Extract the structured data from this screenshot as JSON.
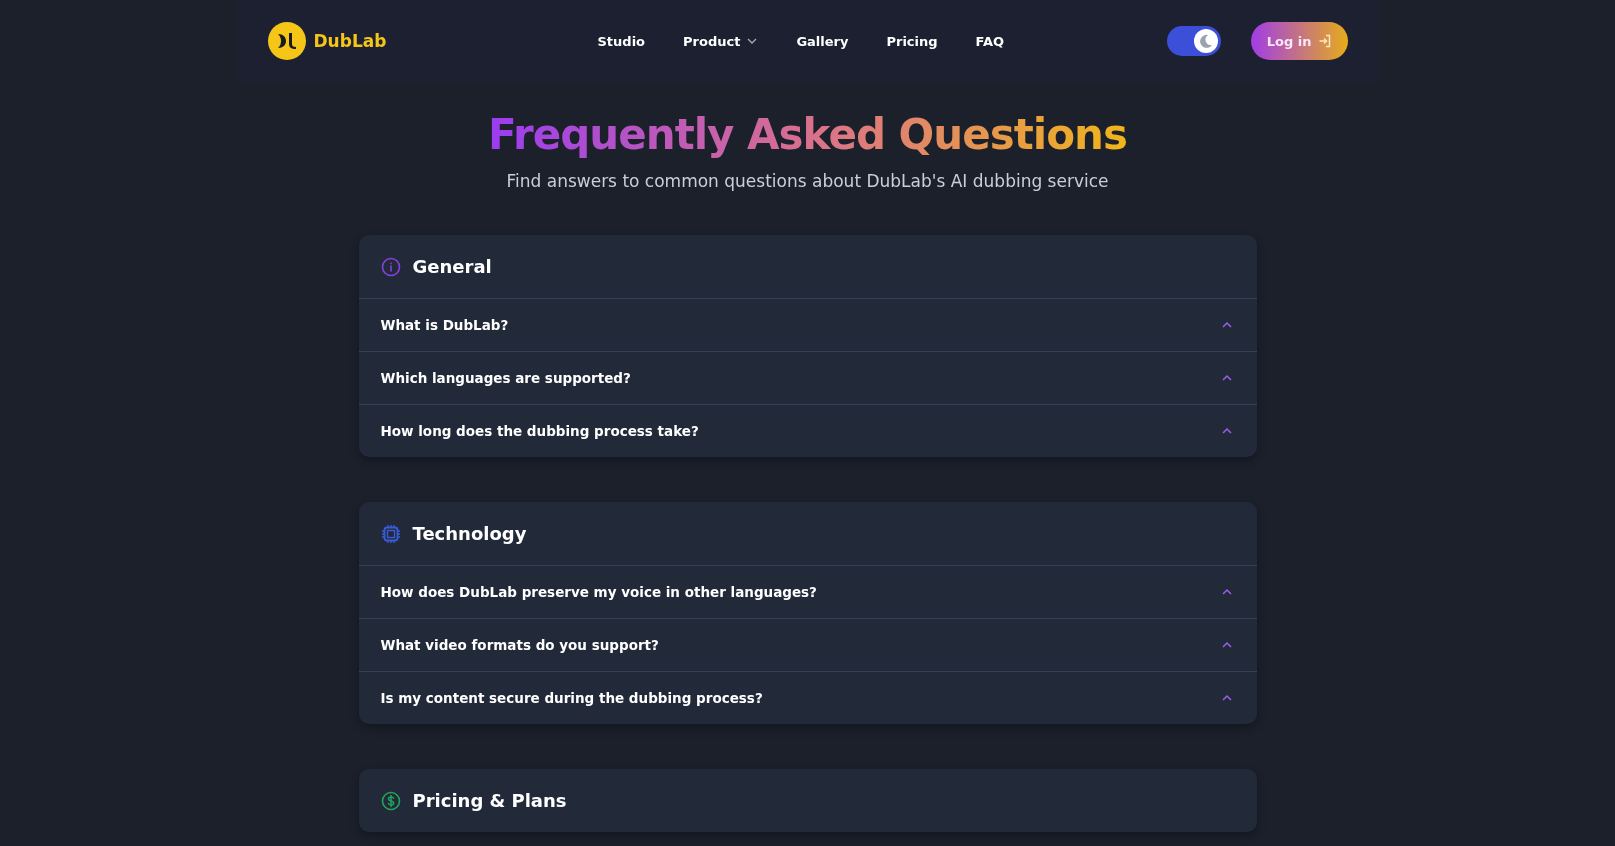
{
  "header": {
    "logo": "DubLab",
    "nav": [
      {
        "label": "Studio",
        "dropdown": false
      },
      {
        "label": "Product",
        "dropdown": true
      },
      {
        "label": "Gallery",
        "dropdown": false
      },
      {
        "label": "Pricing",
        "dropdown": false
      },
      {
        "label": "FAQ",
        "dropdown": false
      }
    ],
    "dark_mode": {
      "on": true
    },
    "login": "Log in"
  },
  "hero": {
    "title": "Frequently Asked Questions",
    "subtitle": "Find answers to common questions about DubLab's AI dubbing service"
  },
  "sections": [
    {
      "kind": "info",
      "title": "General",
      "questions": [
        {
          "text": "What is DubLab?",
          "expanded": false
        },
        {
          "text": "Which languages are supported?",
          "expanded": false
        },
        {
          "text": "How long does the dubbing process take?",
          "expanded": false
        }
      ]
    },
    {
      "kind": "chip",
      "title": "Technology",
      "questions": [
        {
          "text": "How does DubLab preserve my voice in other languages?",
          "expanded": false
        },
        {
          "text": "What video formats do you support?",
          "expanded": false
        },
        {
          "text": "Is my content secure during the dubbing process?",
          "expanded": false
        }
      ]
    },
    {
      "kind": "dollar",
      "title": "Pricing & Plans"
    }
  ]
}
